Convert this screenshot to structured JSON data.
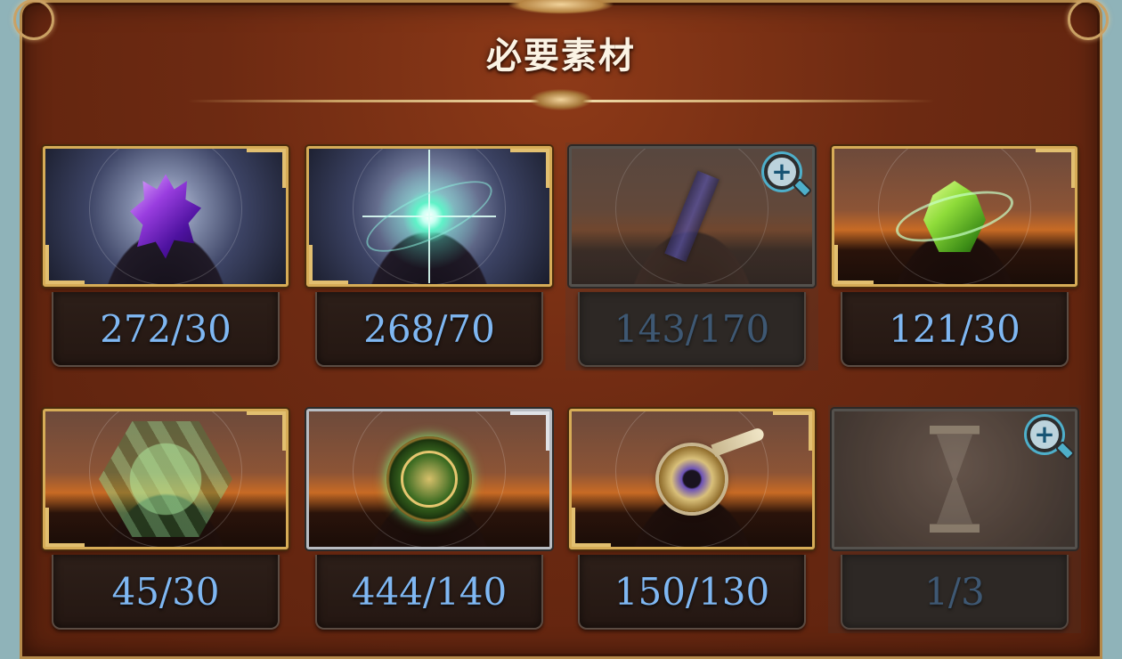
{
  "header": {
    "title": "必要素材"
  },
  "materials": [
    {
      "id": "m1",
      "count": "272/30",
      "style": "cool",
      "icon": "purple-crystal-icon",
      "locked": false
    },
    {
      "id": "m2",
      "count": "268/70",
      "style": "cool",
      "icon": "glowing-star-orb-icon",
      "locked": false
    },
    {
      "id": "m3",
      "count": "143/170",
      "style": "dim",
      "icon": "dark-shard-icon",
      "locked": true,
      "zoom": true
    },
    {
      "id": "m4",
      "count": "121/30",
      "style": "warm",
      "icon": "green-crystal-icon",
      "locked": false
    },
    {
      "id": "m5",
      "count": "45/30",
      "style": "warm",
      "icon": "hexagon-pattern-icon",
      "locked": false
    },
    {
      "id": "m6",
      "count": "444/140",
      "style": "warm",
      "icon": "green-compass-icon",
      "locked": false,
      "frame": "silver"
    },
    {
      "id": "m7",
      "count": "150/130",
      "style": "warm",
      "icon": "eye-horn-artifact-icon",
      "locked": false
    },
    {
      "id": "m8",
      "count": "1/3",
      "style": "grey",
      "icon": "hourglass-icon",
      "locked": true,
      "zoom": true
    }
  ],
  "colors": {
    "count_text": "#7fb7f2",
    "count_text_dim": "#3f5e7f",
    "gold_frame": "#d6ac57",
    "panel": "#6d2a12",
    "zoom_accent": "#52c8ea"
  }
}
